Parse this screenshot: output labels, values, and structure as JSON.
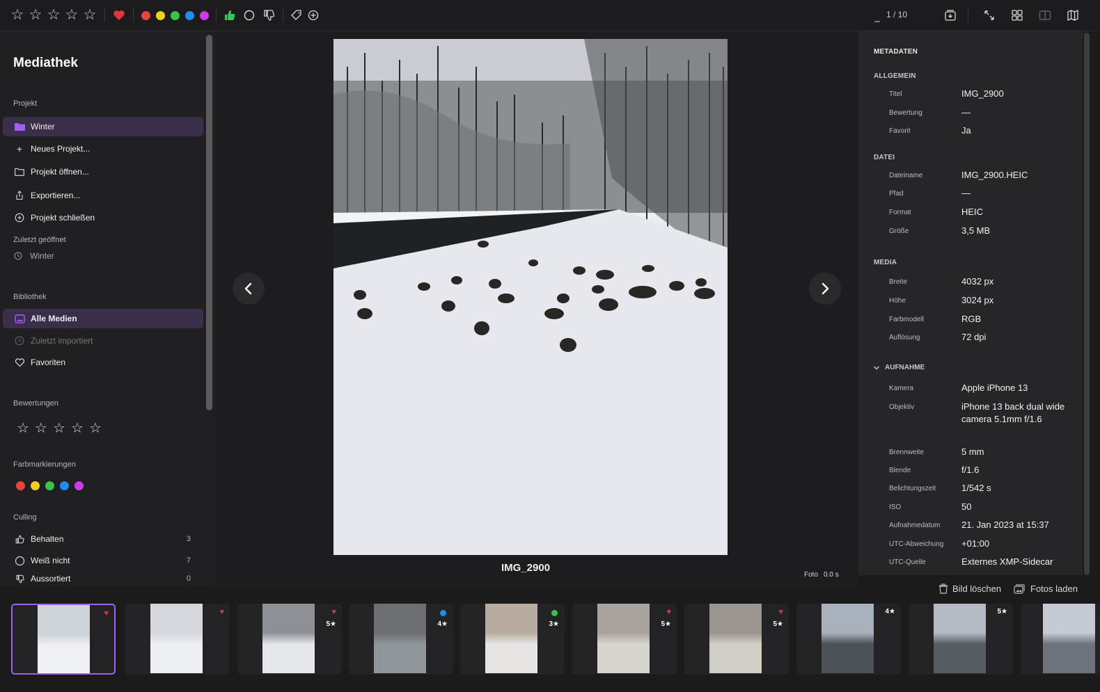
{
  "toolbar": {
    "counter": "1 / 10",
    "colors": [
      "#e8443a",
      "#f2cf1f",
      "#36c44a",
      "#1e8cf0",
      "#cd3ce8"
    ],
    "heart_color": "#e8333a",
    "thumb_up_color": "#34c759"
  },
  "sidebar": {
    "title": "Mediathek",
    "project_label": "Projekt",
    "project_items": [
      "Winter",
      "Neues Projekt...",
      "Projekt öffnen...",
      "Exportieren...",
      "Projekt schließen"
    ],
    "recent_label": "Zuletzt geöffnet",
    "recent_items": [
      "Winter"
    ],
    "library_label": "Bibliothek",
    "library_items": [
      "Alle Medien",
      "Zuletzt importiert",
      "Favoriten"
    ],
    "ratings_label": "Bewertungen",
    "colors_label": "Farbmarkierungen",
    "culling_label": "Culling",
    "culling_items": [
      {
        "label": "Behalten",
        "count": "3"
      },
      {
        "label": "Weiß nicht",
        "count": "7"
      },
      {
        "label": "Aussortiert",
        "count": "0"
      }
    ]
  },
  "viewer": {
    "title": "IMG_2900",
    "type": "Foto",
    "duration": "0.0 s"
  },
  "metadata": {
    "header": "METADATEN",
    "general": {
      "label": "ALLGEMEIN",
      "rows": [
        [
          "Titel",
          "IMG_2900"
        ],
        [
          "Bewertung",
          "—"
        ],
        [
          "Favorit",
          "Ja"
        ]
      ]
    },
    "file": {
      "label": "DATEI",
      "rows": [
        [
          "Dateiname",
          "IMG_2900.HEIC"
        ],
        [
          "Pfad",
          "—"
        ],
        [
          "Format",
          "HEIC"
        ],
        [
          "Größe",
          "3,5 MB"
        ]
      ]
    },
    "media": {
      "label": "MEDIA",
      "rows": [
        [
          "Breite",
          "4032 px"
        ],
        [
          "Höhe",
          "3024 px"
        ],
        [
          "Farbmodell",
          "RGB"
        ],
        [
          "Auflösung",
          "72 dpi"
        ]
      ]
    },
    "capture": {
      "label": "AUFNAHME",
      "rows": [
        [
          "Kamera",
          "Apple iPhone 13"
        ],
        [
          "Objektiv",
          "iPhone 13 back dual wide camera 5.1mm f/1.6"
        ],
        [
          "Brennweite",
          "5 mm"
        ],
        [
          "Blende",
          "f/1.6"
        ],
        [
          "Belichtungszeit",
          "1/542 s"
        ],
        [
          "ISO",
          "50"
        ],
        [
          "Aufnahmedatum",
          "21. Jan 2023 at 15:37"
        ],
        [
          "UTC-Abweichung",
          "+01:00"
        ],
        [
          "UTC-Quelle",
          "Externes XMP-Sidecar"
        ]
      ]
    }
  },
  "actions": {
    "delete": "Bild löschen",
    "load": "Fotos laden"
  },
  "filmstrip": [
    {
      "badge": "heart",
      "stars": ""
    },
    {
      "badge": "heart",
      "stars": ""
    },
    {
      "badge": "heart",
      "stars": "5★"
    },
    {
      "badge": "blue",
      "stars": "4★"
    },
    {
      "badge": "green",
      "stars": "3★"
    },
    {
      "badge": "heart",
      "stars": "5★"
    },
    {
      "badge": "heart",
      "stars": "5★"
    },
    {
      "badge": "",
      "stars": "4★"
    },
    {
      "badge": "",
      "stars": "5★"
    },
    {
      "badge": "",
      "stars": ""
    }
  ]
}
